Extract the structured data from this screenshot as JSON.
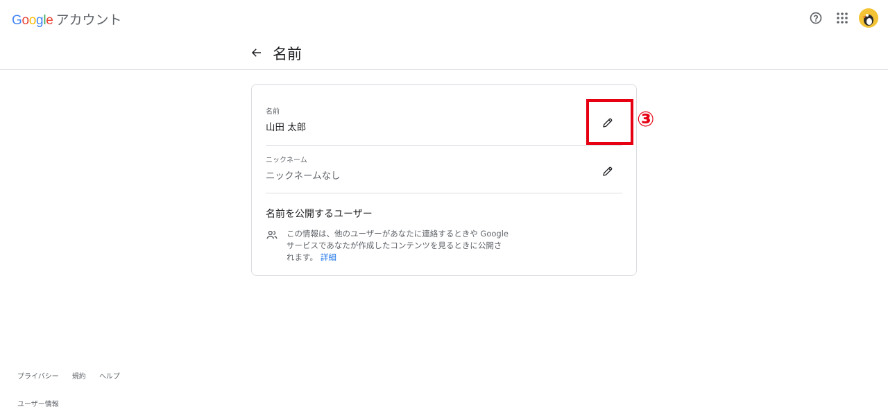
{
  "header": {
    "logo_letters": [
      "G",
      "o",
      "o",
      "g",
      "l",
      "e"
    ],
    "logo_colors": [
      "#4285f4",
      "#ea4335",
      "#fbbc05",
      "#4285f4",
      "#34a853",
      "#ea4335"
    ],
    "product_name": "アカウント",
    "icons": [
      "help-icon",
      "apps-icon",
      "avatar"
    ]
  },
  "page": {
    "title": "名前"
  },
  "card": {
    "name_row": {
      "label": "名前",
      "value": "山田 太郎"
    },
    "nickname_row": {
      "label": "ニックネーム",
      "value": "ニックネームなし"
    },
    "visibility": {
      "title": "名前を公開するユーザー",
      "text": "この情報は、他のユーザーがあなたに連絡するときや Google サービスであなたが作成したコンテンツを見るときに公開されます。",
      "link": "詳細"
    }
  },
  "annotation": {
    "step": "③",
    "color": "#e60012"
  },
  "footer": {
    "links": [
      "プライバシー",
      "規約",
      "ヘルプ"
    ],
    "user_info": "ユーザー情報"
  }
}
